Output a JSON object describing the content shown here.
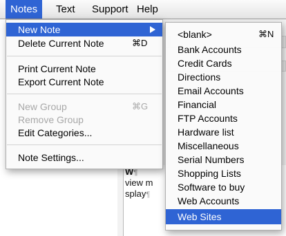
{
  "menubar": {
    "items": [
      {
        "label": "Notes"
      },
      {
        "label": "Text"
      },
      {
        "label": "Support"
      },
      {
        "label": "Help"
      }
    ]
  },
  "notes_menu": {
    "new_note": "New Note",
    "delete_current_note": "Delete Current Note",
    "delete_shortcut": "⌘D",
    "print_current_note": "Print Current Note",
    "export_current_note": "Export Current Note",
    "new_group": "New Group",
    "new_group_shortcut": "⌘G",
    "remove_group": "Remove Group",
    "edit_categories": "Edit Categories...",
    "note_settings": "Note Settings..."
  },
  "new_note_submenu": {
    "blank": "<blank>",
    "blank_shortcut": "⌘N",
    "items": [
      "Bank Accounts",
      "Credit Cards",
      "Directions",
      "Email Accounts",
      "Financial",
      "FTP Accounts",
      "Hardware list",
      "Miscellaneous",
      "Serial Numbers",
      "Shopping Lists",
      "Software to buy",
      "Web Accounts",
      "Web Sites"
    ]
  },
  "background_editor": {
    "line1": "W",
    "line2": "view m",
    "line3": "splay",
    "pilcrow": "¶"
  },
  "colors": {
    "highlight": "#2f64d4",
    "disabled_text": "#a8a8a8"
  }
}
